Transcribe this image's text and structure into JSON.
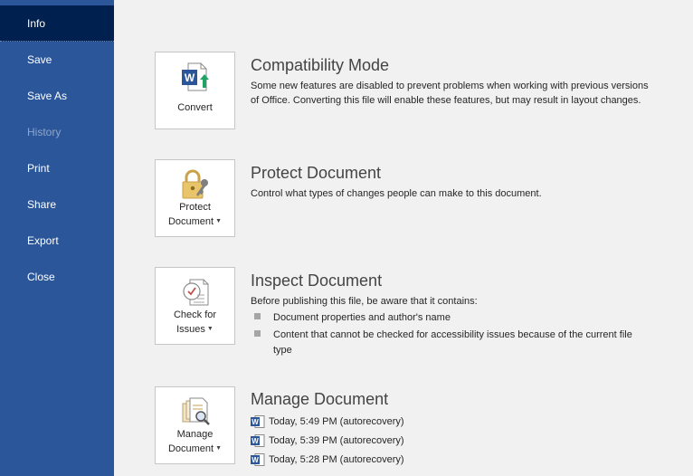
{
  "sidebar": {
    "items": [
      {
        "label": "Info",
        "state": "active"
      },
      {
        "label": "Save",
        "state": "normal"
      },
      {
        "label": "Save As",
        "state": "normal"
      },
      {
        "label": "History",
        "state": "disabled"
      },
      {
        "label": "Print",
        "state": "normal"
      },
      {
        "label": "Share",
        "state": "normal"
      },
      {
        "label": "Export",
        "state": "normal"
      },
      {
        "label": "Close",
        "state": "normal"
      }
    ]
  },
  "compatibility": {
    "button_label": "Convert",
    "icon": "word-convert-icon",
    "title": "Compatibility Mode",
    "description": "Some new features are disabled to prevent problems when working with previous versions of Office. Converting this file will enable these features, but may result in layout changes."
  },
  "protect": {
    "button_line1": "Protect",
    "button_line2": "Document",
    "icon": "lock-key-icon",
    "title": "Protect Document",
    "description": "Control what types of changes people can make to this document."
  },
  "inspect": {
    "button_line1": "Check for",
    "button_line2": "Issues",
    "icon": "checklist-icon",
    "title": "Inspect Document",
    "description": "Before publishing this file, be aware that it contains:",
    "bullets": [
      "Document properties and author's name",
      "Content that cannot be checked for accessibility issues because of the current file type"
    ]
  },
  "manage": {
    "button_line1": "Manage",
    "button_line2": "Document",
    "icon": "manage-document-icon",
    "title": "Manage Document",
    "versions": [
      "Today, 5:49 PM (autorecovery)",
      "Today, 5:39 PM (autorecovery)",
      "Today, 5:28 PM (autorecovery)"
    ]
  },
  "colors": {
    "sidebar": "#2b579a",
    "sidebar_active": "#002050",
    "background": "#f1f1f1",
    "word_blue": "#2b579a"
  }
}
